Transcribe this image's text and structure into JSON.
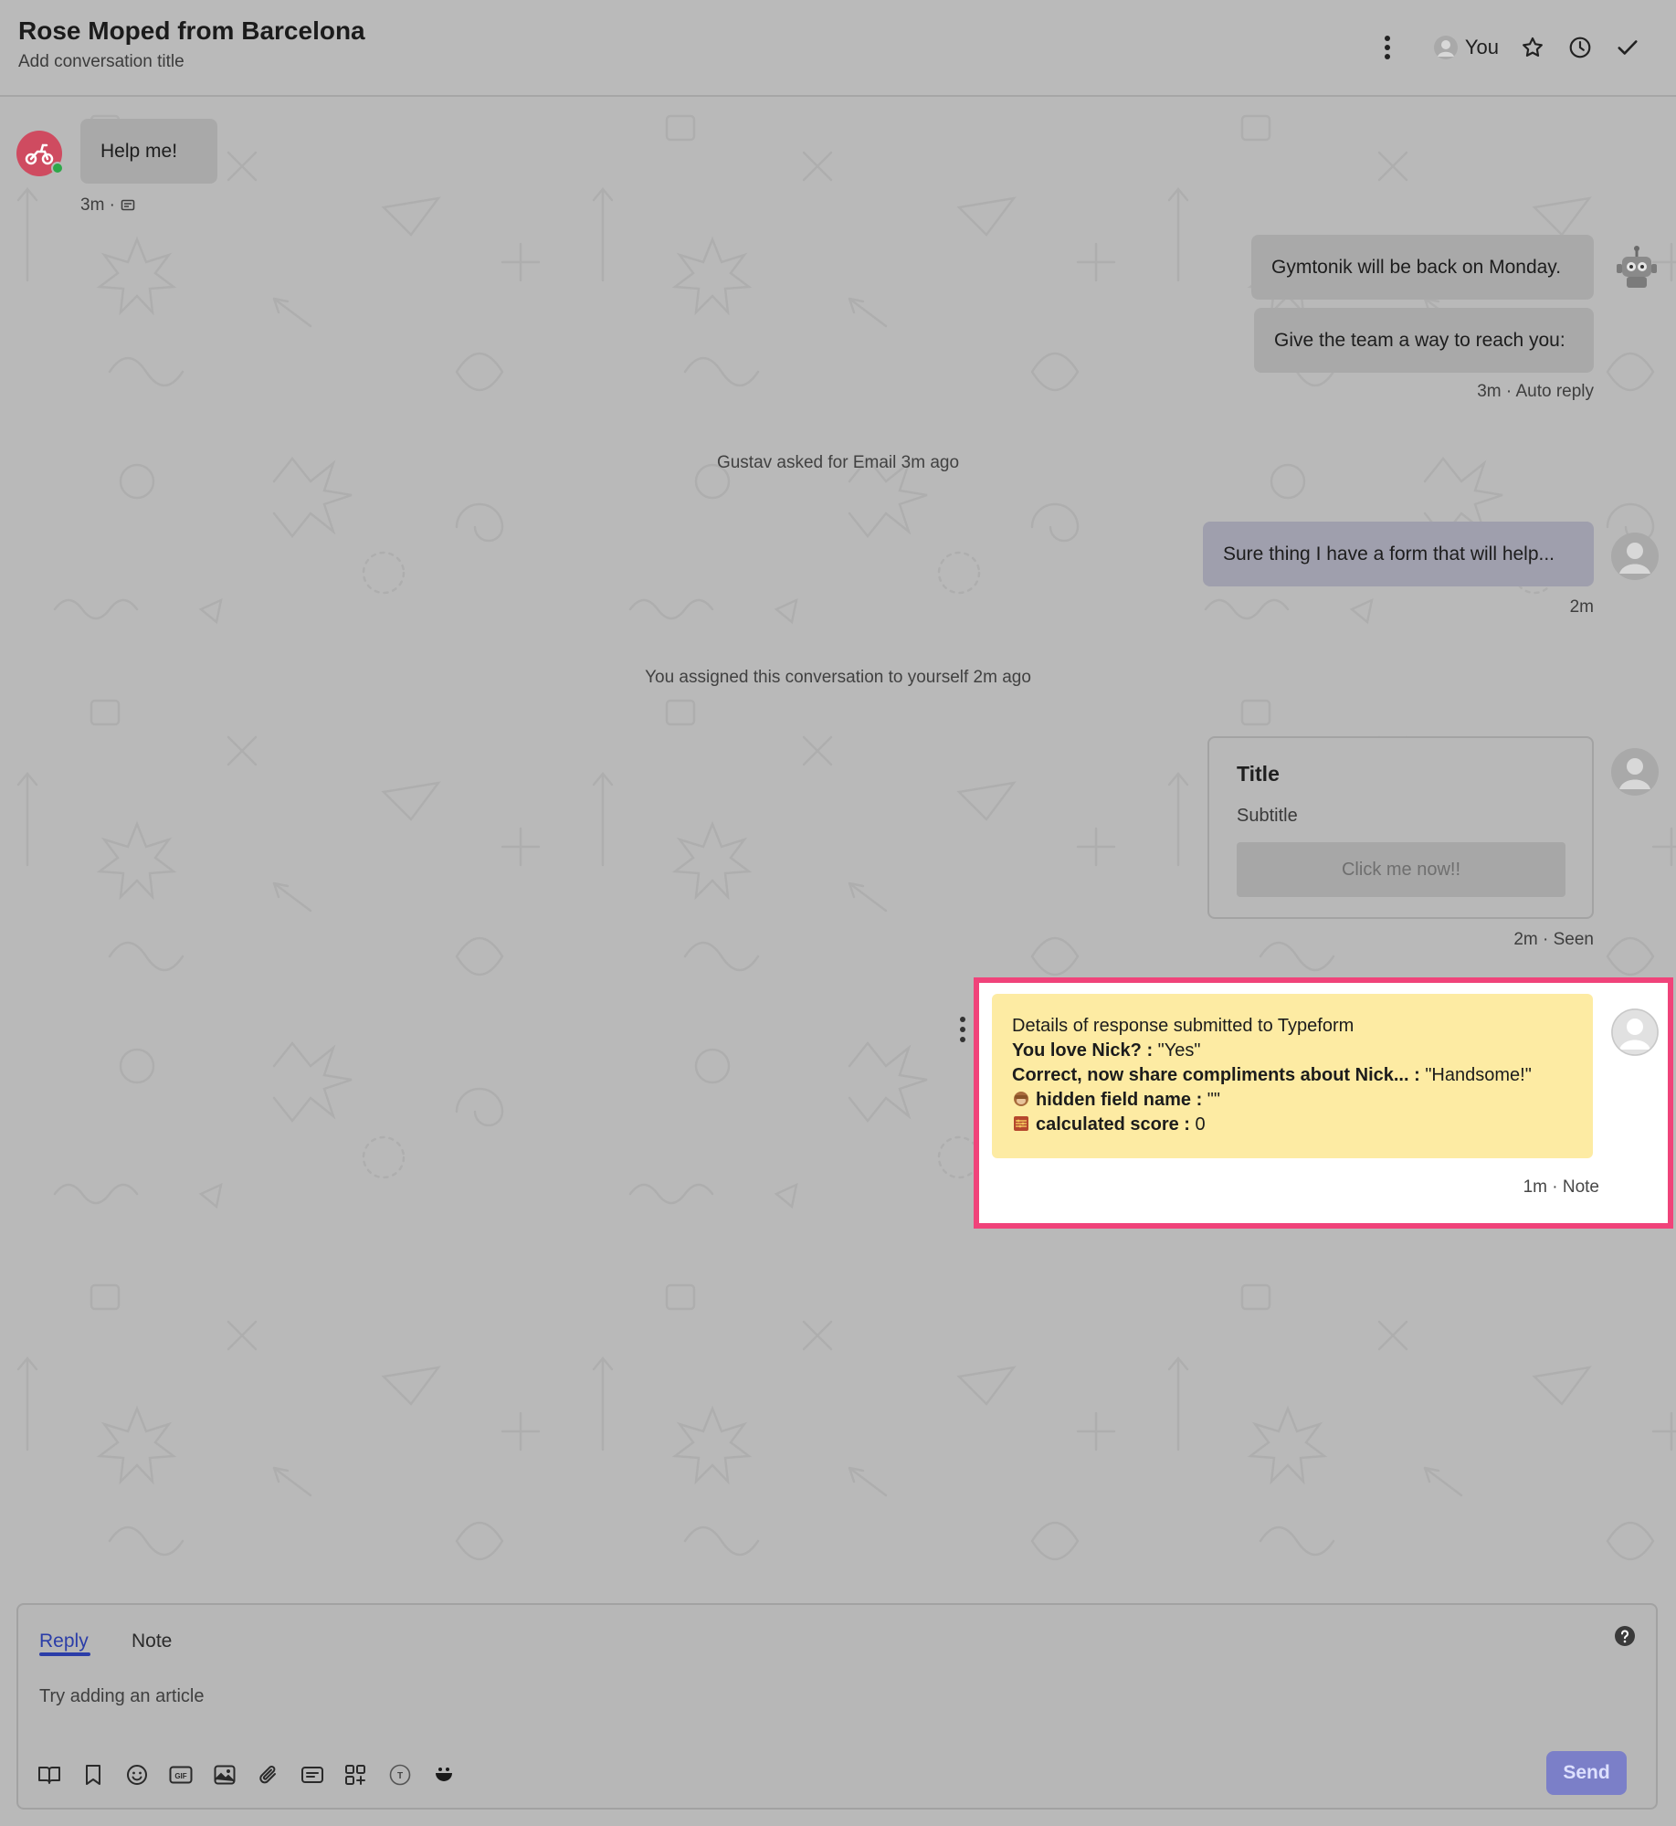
{
  "header": {
    "title": "Rose Moped from Barcelona",
    "subtitle": "Add conversation title",
    "assignee": "You",
    "icons": [
      "more-vertical-icon",
      "user-avatar-icon",
      "star-icon",
      "clock-icon",
      "check-icon"
    ]
  },
  "messages": {
    "user_message": {
      "text": "Help me!",
      "meta": "3m ·"
    },
    "auto_reply_1": "Gymtonik will be back on Monday.",
    "auto_reply_2": "Give the team a way to reach you:",
    "auto_reply_meta": "3m · Auto reply",
    "system_1": "Gustav asked for Email 3m ago",
    "agent_reply": {
      "text": "Sure thing I have a form that will help...",
      "meta": "2m"
    },
    "system_2": "You assigned this conversation to yourself 2m ago",
    "card": {
      "title": "Title",
      "subtitle": "Subtitle",
      "button": "Click me now!!",
      "meta": "2m · Seen"
    },
    "note": {
      "heading": "Details of response submitted to Typeform",
      "q1_label": "You love Nick? :",
      "q1_value": " \"Yes\"",
      "q2_label": "Correct, now share compliments about Nick... :",
      "q2_value": " \"Handsome!\"",
      "q3_label": "hidden field name :",
      "q3_value": " \"\"",
      "q4_label": "calculated score :",
      "q4_value": " 0",
      "meta": "1m · Note"
    }
  },
  "composer": {
    "tabs": [
      "Reply",
      "Note"
    ],
    "active_tab": "Reply",
    "placeholder": "Try adding an article",
    "send_label": "Send",
    "tools": [
      "book-icon",
      "bookmark-icon",
      "emoji-icon",
      "gif-icon",
      "image-icon",
      "paperclip-icon",
      "ticket-icon",
      "apps-add-icon",
      "text-format-icon",
      "smile-face-icon"
    ]
  },
  "colors": {
    "accent": "#2b3da8",
    "send": "#7b7fc8",
    "note_bg": "#fdeba3",
    "highlight_border": "#f0437a",
    "user_avatar": "#cf4b60",
    "online": "#2ea84a"
  }
}
